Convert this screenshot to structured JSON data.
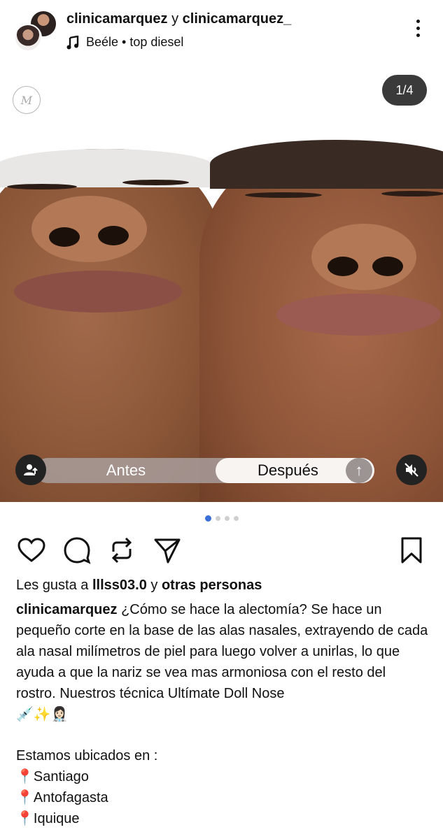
{
  "header": {
    "account_primary": "clinicamarquez",
    "account_joiner": " y ",
    "account_secondary": "clinicamarquez_",
    "music_artist": "Beéle",
    "music_separator": " • ",
    "music_track": "top diesel",
    "icons": [
      "music-note-icon",
      "more-vertical-icon"
    ]
  },
  "media": {
    "counter": "1/4",
    "logo_letter": "M",
    "slider": {
      "left_label": "Antes",
      "right_label": "Después"
    },
    "icons": [
      "user-tag-icon",
      "arrow-up-icon",
      "mute-icon"
    ]
  },
  "carousel": {
    "total": 4,
    "active_index": 0
  },
  "actions": {
    "icons": [
      "heart-icon",
      "comment-icon",
      "repost-icon",
      "share-icon",
      "bookmark-icon"
    ]
  },
  "likes": {
    "prefix": "Les gusta a ",
    "user": "lllss03.0",
    "middle": " y ",
    "others": "otras personas"
  },
  "caption": {
    "author": "clinicamarquez",
    "text": " ¿Cómo se hace la alectomía? Se hace un pequeño corte en la base de las alas nasales, extrayendo de cada ala nasal milímetros de piel para luego volver a unirlas, lo que ayuda a que la nariz se vea mas armoniosa con el resto del rostro. Nuestros técnica Ultímate Doll Nose",
    "emojis": "💉✨👩🏻‍⚕️"
  },
  "locations": {
    "intro": "Estamos ubicados en :",
    "pin_icon": "📍",
    "cities": [
      "Santiago",
      "Antofagasta",
      "Iquique"
    ]
  },
  "colors": {
    "accent_dot": "#3a6fd8",
    "pin": "#e03131",
    "overlay_dark": "#222222"
  }
}
